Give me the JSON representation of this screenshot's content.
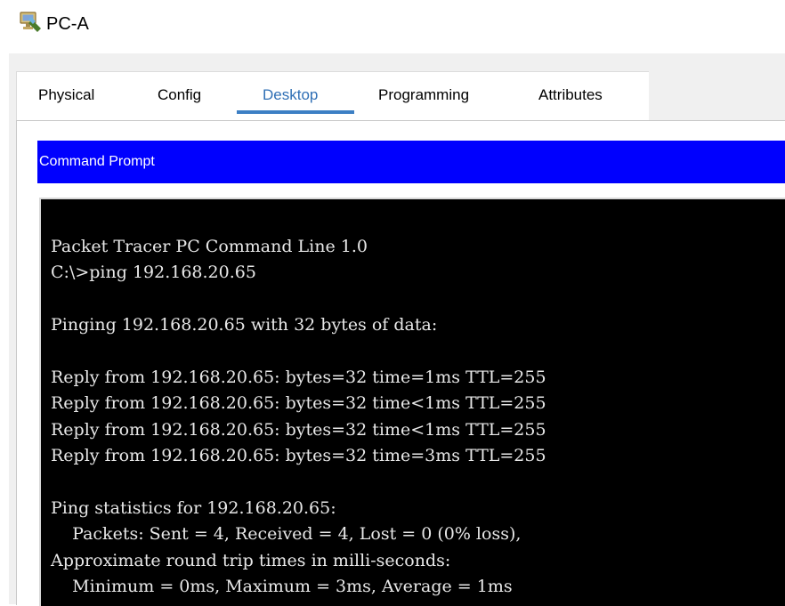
{
  "window": {
    "title": "PC-A",
    "icon": "pc-icon"
  },
  "tabs": [
    {
      "label": "Physical",
      "active": false
    },
    {
      "label": "Config",
      "active": false
    },
    {
      "label": "Desktop",
      "active": true
    },
    {
      "label": "Programming",
      "active": false
    },
    {
      "label": "Attributes",
      "active": false
    }
  ],
  "command_prompt": {
    "title": "Command Prompt",
    "lines": [
      "Packet Tracer PC Command Line 1.0",
      "C:\\>ping 192.168.20.65",
      "",
      "Pinging 192.168.20.65 with 32 bytes of data:",
      "",
      "Reply from 192.168.20.65: bytes=32 time=1ms TTL=255",
      "Reply from 192.168.20.65: bytes=32 time<1ms TTL=255",
      "Reply from 192.168.20.65: bytes=32 time<1ms TTL=255",
      "Reply from 192.168.20.65: bytes=32 time=3ms TTL=255",
      "",
      "Ping statistics for 192.168.20.65:",
      "    Packets: Sent = 4, Received = 4, Lost = 0 (0% loss),",
      "Approximate round trip times in milli-seconds:",
      "    Minimum = 0ms, Maximum = 3ms, Average = 1ms"
    ]
  },
  "colors": {
    "header_blue": "#0000fe",
    "active_tab": "#2f6fb5",
    "terminal_bg": "#000000",
    "terminal_text": "#e8e8e8"
  }
}
